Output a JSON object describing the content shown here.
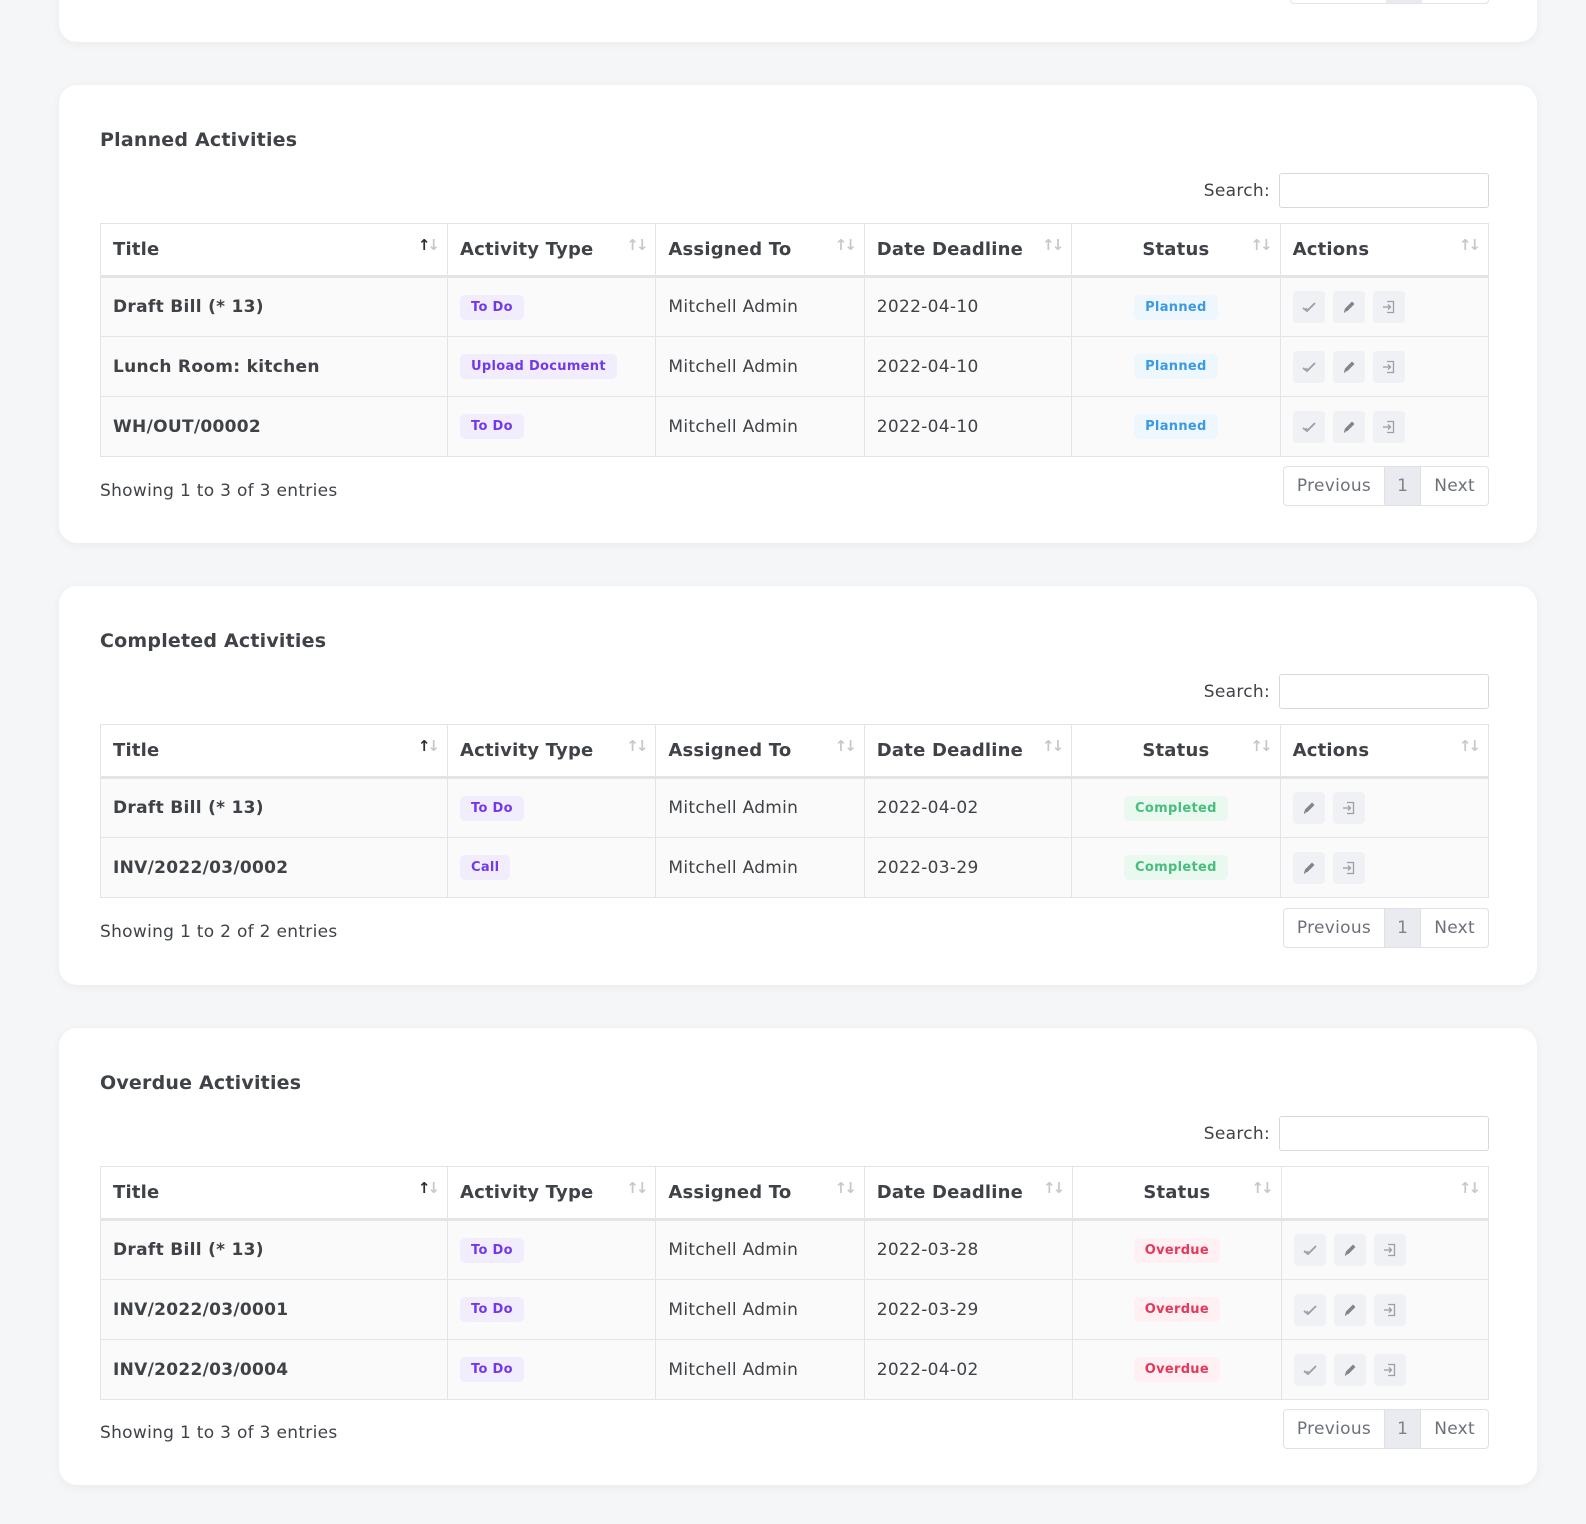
{
  "pager": {
    "previous": "Previous",
    "page": "1",
    "next": "Next"
  },
  "search_label": "Search:",
  "columns": {
    "title": "Title",
    "activity_type": "Activity Type",
    "assigned_to": "Assigned To",
    "date_deadline": "Date Deadline",
    "status": "Status",
    "actions": "Actions"
  },
  "planned": {
    "title": "Planned Activities",
    "rows": [
      {
        "title": "Draft Bill (* 13)",
        "type": "To Do",
        "assigned": "Mitchell Admin",
        "deadline": "2022-04-10",
        "status": "Planned"
      },
      {
        "title": "Lunch Room: kitchen",
        "type": "Upload Document",
        "assigned": "Mitchell Admin",
        "deadline": "2022-04-10",
        "status": "Planned"
      },
      {
        "title": "WH/OUT/00002",
        "type": "To Do",
        "assigned": "Mitchell Admin",
        "deadline": "2022-04-10",
        "status": "Planned"
      }
    ],
    "info": "Showing 1 to 3 of 3 entries"
  },
  "completed": {
    "title": "Completed Activities",
    "rows": [
      {
        "title": "Draft Bill (* 13)",
        "type": "To Do",
        "assigned": "Mitchell Admin",
        "deadline": "2022-04-02",
        "status": "Completed"
      },
      {
        "title": "INV/2022/03/0002",
        "type": "Call",
        "assigned": "Mitchell Admin",
        "deadline": "2022-03-29",
        "status": "Completed"
      }
    ],
    "info": "Showing 1 to 2 of 2 entries"
  },
  "overdue": {
    "title": "Overdue Activities",
    "rows": [
      {
        "title": "Draft Bill (* 13)",
        "type": "To Do",
        "assigned": "Mitchell Admin",
        "deadline": "2022-03-28",
        "status": "Overdue"
      },
      {
        "title": "INV/2022/03/0001",
        "type": "To Do",
        "assigned": "Mitchell Admin",
        "deadline": "2022-03-29",
        "status": "Overdue"
      },
      {
        "title": "INV/2022/03/0004",
        "type": "To Do",
        "assigned": "Mitchell Admin",
        "deadline": "2022-04-02",
        "status": "Overdue"
      }
    ],
    "info": "Showing 1 to 3 of 3 entries"
  },
  "icons": {
    "mark_done": "check-icon",
    "edit": "pencil-icon",
    "open": "open-record-icon"
  },
  "colors": {
    "type_badge": "#7239ea",
    "planned": "#3b9ae1",
    "completed": "#47be7d",
    "overdue": "#e6385a"
  }
}
